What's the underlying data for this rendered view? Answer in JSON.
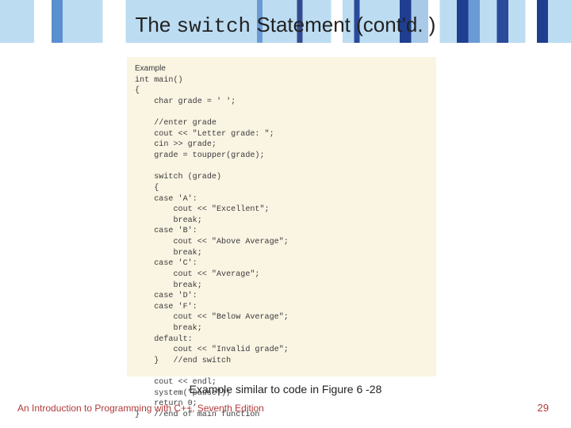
{
  "title": {
    "pre": "The ",
    "mono": "switch",
    "post": " Statement (cont'd. )"
  },
  "code": {
    "label": "Example",
    "lines": [
      "int main()",
      "{",
      "    char grade = ' ';",
      "",
      "    //enter grade",
      "    cout << \"Letter grade: \";",
      "    cin >> grade;",
      "    grade = toupper(grade);",
      "",
      "    switch (grade)",
      "    {",
      "    case 'A':",
      "        cout << \"Excellent\";",
      "        break;",
      "    case 'B':",
      "        cout << \"Above Average\";",
      "        break;",
      "    case 'C':",
      "        cout << \"Average\";",
      "        break;",
      "    case 'D':",
      "    case 'F':",
      "        cout << \"Below Average\";",
      "        break;",
      "    default:",
      "        cout << \"Invalid grade\";",
      "    }   //end switch",
      "",
      "    cout << endl;",
      "    system(\"pause\");",
      "    return 0;",
      "}   //end of main function"
    ]
  },
  "caption": "Example similar to code in Figure 6 -28",
  "footer": {
    "text": "An Introduction to Programming with C++, Seventh Edition",
    "page": "29"
  }
}
